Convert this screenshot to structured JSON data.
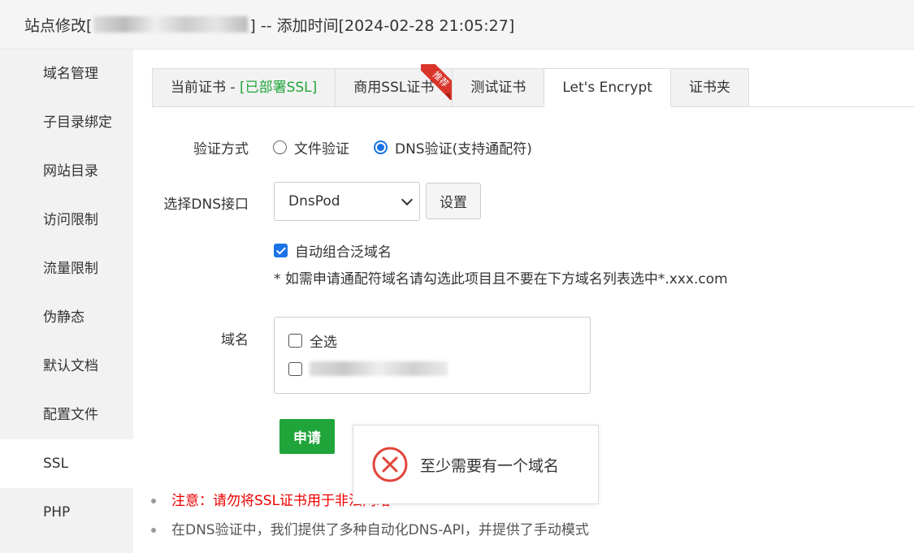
{
  "header": {
    "title_prefix": "站点修改[",
    "title_suffix": "] -- 添加时间[2024-02-28 21:05:27]"
  },
  "sidebar": {
    "items": [
      {
        "label": "域名管理"
      },
      {
        "label": "子目录绑定"
      },
      {
        "label": "网站目录"
      },
      {
        "label": "访问限制"
      },
      {
        "label": "流量限制"
      },
      {
        "label": "伪静态"
      },
      {
        "label": "默认文档"
      },
      {
        "label": "配置文件"
      },
      {
        "label": "SSL"
      },
      {
        "label": "PHP"
      }
    ],
    "active": "SSL"
  },
  "tabs": {
    "current_cert": "当前证书 - ",
    "current_cert_status": "[已部署SSL]",
    "commercial": "商用SSL证书",
    "ribbon": "推荐",
    "test_cert": "测试证书",
    "letsencrypt": "Let's Encrypt",
    "cert_folder": "证书夹",
    "active": "Let's Encrypt"
  },
  "form": {
    "verify_label": "验证方式",
    "verify_file": "文件验证",
    "verify_dns": "DNS验证(支持通配符)",
    "verify_selected": "DNS验证(支持通配符)",
    "dns_label": "选择DNS接口",
    "dns_value": "DnsPod",
    "settings_button": "设置",
    "auto_combine": "自动组合泛域名",
    "auto_combine_checked": true,
    "hint": "* 如需申请通配符域名请勾选此项目且不要在下方域名列表选中*.xxx.com",
    "domain_label": "域名",
    "select_all": "全选",
    "domain_item_suffix": "...",
    "apply_button": "申请"
  },
  "toast": {
    "message": "至少需要有一个域名"
  },
  "notes": [
    "注意：请勿将SSL证书用于非法网站",
    "在DNS验证中，我们提供了多种自动化DNS-API，并提供了手动模式"
  ],
  "colors": {
    "green": "#20a53a",
    "blue": "#1a73e8",
    "red": "#e00000",
    "toast_icon": "#e0443a"
  }
}
